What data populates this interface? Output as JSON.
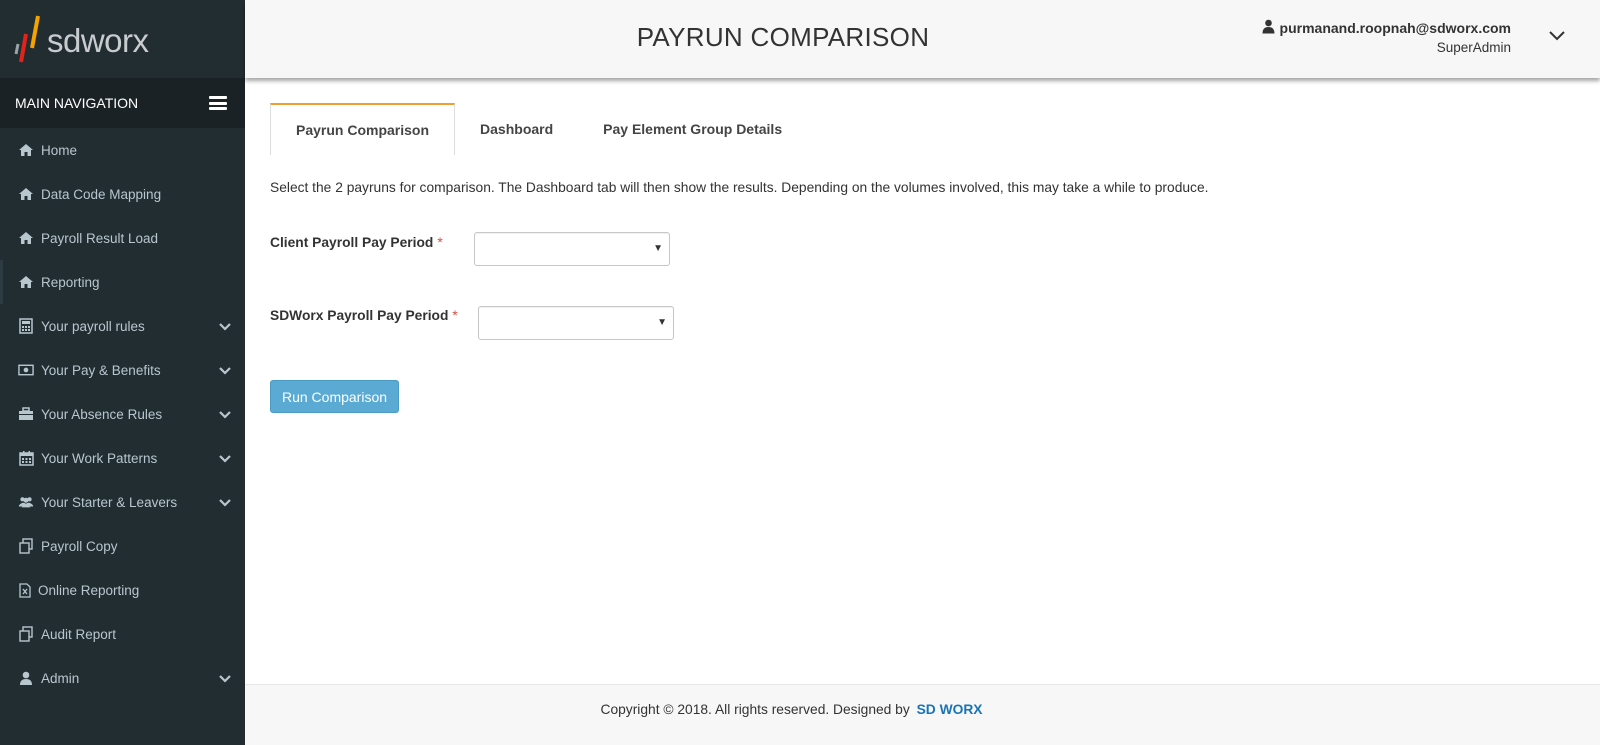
{
  "brand": {
    "logo_text": "sdworx",
    "colors": {
      "sidebar": "#222d32",
      "accent": "#f0a030",
      "button": "#5aaad4",
      "link": "#1a73b5"
    }
  },
  "sidebar": {
    "header": "MAIN NAVIGATION",
    "items": [
      {
        "label": "Home",
        "icon": "home-icon",
        "expandable": false
      },
      {
        "label": "Data Code Mapping",
        "icon": "home-icon",
        "expandable": false
      },
      {
        "label": "Payroll Result Load",
        "icon": "home-icon",
        "expandable": false
      },
      {
        "label": "Reporting",
        "icon": "home-icon",
        "expandable": false
      },
      {
        "label": "Your payroll rules",
        "icon": "calculator-icon",
        "expandable": true
      },
      {
        "label": "Your Pay & Benefits",
        "icon": "money-icon",
        "expandable": true
      },
      {
        "label": "Your Absence Rules",
        "icon": "briefcase-icon",
        "expandable": true
      },
      {
        "label": "Your Work Patterns",
        "icon": "calendar-icon",
        "expandable": true
      },
      {
        "label": "Your Starter & Leavers",
        "icon": "users-icon",
        "expandable": true
      },
      {
        "label": "Payroll Copy",
        "icon": "copy-icon",
        "expandable": false
      },
      {
        "label": "Online Reporting",
        "icon": "file-excel-icon",
        "expandable": false
      },
      {
        "label": "Audit Report",
        "icon": "copy-icon",
        "expandable": false
      },
      {
        "label": "Admin",
        "icon": "user-icon",
        "expandable": true
      }
    ]
  },
  "header": {
    "title": "PAYRUN COMPARISON",
    "user_email": "purmanand.roopnah@sdworx.com",
    "user_role": "SuperAdmin"
  },
  "tabs": [
    {
      "label": "Payrun Comparison",
      "active": true
    },
    {
      "label": "Dashboard",
      "active": false
    },
    {
      "label": "Pay Element Group Details",
      "active": false
    }
  ],
  "form": {
    "intro": "Select the 2 payruns for comparison. The Dashboard tab will then show the results. Depending on the volumes involved, this may take a while to produce.",
    "client_label": "Client Payroll Pay Period",
    "client_value": "",
    "sdworx_label": "SDWorx Payroll Pay Period",
    "sdworx_value": "",
    "required_marker": "*",
    "run_button": "Run Comparison"
  },
  "footer": {
    "text": "Copyright © 2018. All rights reserved. Designed by",
    "link": "SD WORX"
  }
}
